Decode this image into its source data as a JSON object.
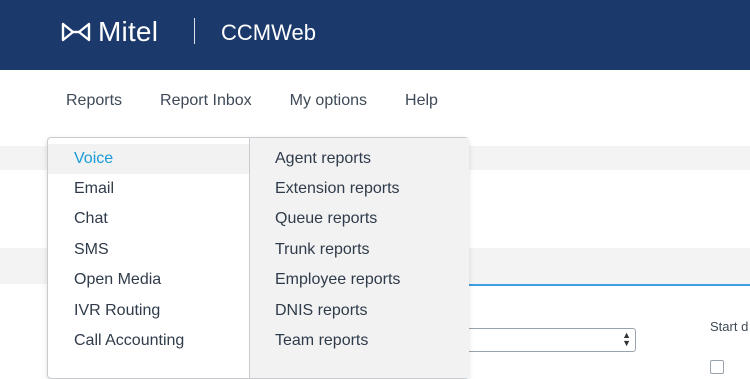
{
  "header": {
    "logo_text": "Mitel",
    "app_title": "CCMWeb",
    "colors": {
      "header_bg": "#1b3a6b",
      "accent": "#1a9bd7"
    }
  },
  "nav": {
    "items": [
      {
        "label": "Reports"
      },
      {
        "label": "Report Inbox"
      },
      {
        "label": "My options"
      },
      {
        "label": "Help"
      }
    ]
  },
  "menu": {
    "categories": [
      {
        "label": "Voice",
        "active": true
      },
      {
        "label": "Email"
      },
      {
        "label": "Chat"
      },
      {
        "label": "SMS"
      },
      {
        "label": "Open Media"
      },
      {
        "label": "IVR Routing"
      },
      {
        "label": "Call Accounting"
      }
    ],
    "subitems": [
      {
        "label": "Agent reports"
      },
      {
        "label": "Extension reports"
      },
      {
        "label": "Queue reports"
      },
      {
        "label": "Trunk reports"
      },
      {
        "label": "Employee reports"
      },
      {
        "label": "DNIS reports"
      },
      {
        "label": "Team reports"
      }
    ]
  },
  "background": {
    "start_label": "Start d"
  }
}
